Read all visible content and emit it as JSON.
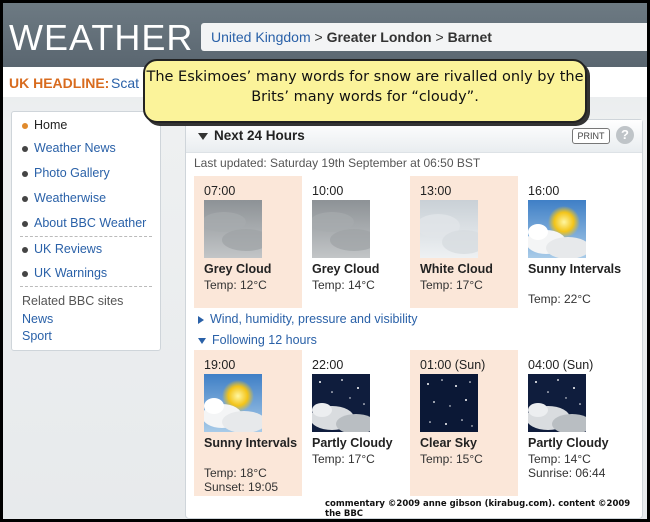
{
  "header": {
    "logo": "WEATHER",
    "breadcrumb": {
      "country": "United Kingdom",
      "sep1": " > ",
      "region": "Greater London",
      "sep2": " > ",
      "place": "Barnet"
    }
  },
  "headline": {
    "label": "UK HEADLINE:",
    "text": "Scat"
  },
  "callout": "The Eskimoes’ many words for snow are rivalled only by the Brits’ many words for “cloudy”.",
  "sidebar": {
    "items": [
      {
        "label": "Home"
      },
      {
        "label": "Weather News"
      },
      {
        "label": "Photo Gallery"
      },
      {
        "label": "Weatherwise"
      },
      {
        "label": "About BBC Weather"
      },
      {
        "label": "UK Reviews"
      },
      {
        "label": "UK Warnings"
      }
    ],
    "related_heading": "Related BBC sites",
    "related_links": [
      {
        "label": "News"
      },
      {
        "label": "Sport"
      }
    ]
  },
  "main": {
    "title": "Next 24 Hours",
    "print_label": "PRINT",
    "help_label": "?",
    "updated": "Last updated: Saturday 19th September at 06:50 BST",
    "row1": [
      {
        "time": "07:00",
        "condition": "Grey Cloud",
        "temp": "Temp: 12°C",
        "icon": "grey-cloud-icon"
      },
      {
        "time": "10:00",
        "condition": "Grey Cloud",
        "temp": "Temp: 14°C",
        "icon": "grey-cloud-icon"
      },
      {
        "time": "13:00",
        "condition": "White Cloud",
        "temp": "Temp: 17°C",
        "icon": "white-cloud-icon"
      },
      {
        "time": "16:00",
        "condition": "Sunny Intervals",
        "temp": "Temp: 22°C",
        "icon": "sunny-intervals-icon"
      }
    ],
    "expander_details": "Wind, humidity, pressure and visibility",
    "expander_following": "Following 12 hours",
    "row2": [
      {
        "time": "19:00",
        "condition": "Sunny Intervals",
        "temp": "Temp: 18°C",
        "extra": "Sunset: 19:05",
        "icon": "sunny-intervals-icon"
      },
      {
        "time": "22:00",
        "condition": "Partly Cloudy",
        "temp": "Temp: 17°C",
        "icon": "partly-cloudy-night-icon"
      },
      {
        "time": "01:00 (Sun)",
        "condition": "Clear Sky",
        "temp": "Temp: 15°C",
        "icon": "clear-sky-night-icon"
      },
      {
        "time": "04:00 (Sun)",
        "condition": "Partly Cloudy",
        "temp": "Temp: 14°C",
        "extra": "Sunrise: 06:44",
        "icon": "partly-cloudy-night-icon"
      }
    ]
  },
  "credit": "commentary ©2009 anne gibson (kirabug.com). content ©2009 the BBC",
  "colors": {
    "accent_orange": "#e08a2c",
    "link_blue": "#2a61a8",
    "slot_shade": "#fbe7d9",
    "callout_yellow": "#fbf39a"
  }
}
